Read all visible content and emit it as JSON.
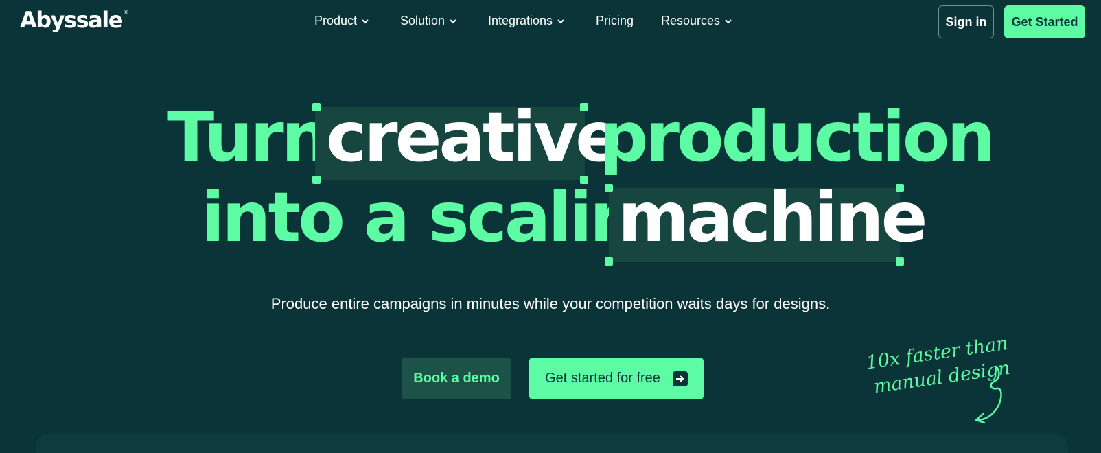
{
  "nav": {
    "logo": "Abyssale",
    "logo_mark": "®",
    "menu": [
      {
        "label": "Product",
        "has_dropdown": true
      },
      {
        "label": "Solution",
        "has_dropdown": true
      },
      {
        "label": "Integrations",
        "has_dropdown": true
      },
      {
        "label": "Pricing",
        "has_dropdown": false
      },
      {
        "label": "Resources",
        "has_dropdown": true
      }
    ],
    "sign_in": "Sign in",
    "get_started": "Get Started"
  },
  "hero": {
    "line1_a": "Turn",
    "line1_highlight": "creative",
    "line1_b": "production",
    "line2_a": "into a scaling",
    "line2_highlight": "machine",
    "subtitle": "Produce entire campaigns in minutes while your competition waits days for designs.",
    "book_demo": "Book a demo",
    "get_started_free": "Get started for free",
    "annotation_line1": "10x faster than",
    "annotation_line2": "manual design"
  },
  "colors": {
    "background": "#0b3438",
    "accent": "#5dfca4",
    "highlight_box": "#16463f"
  }
}
